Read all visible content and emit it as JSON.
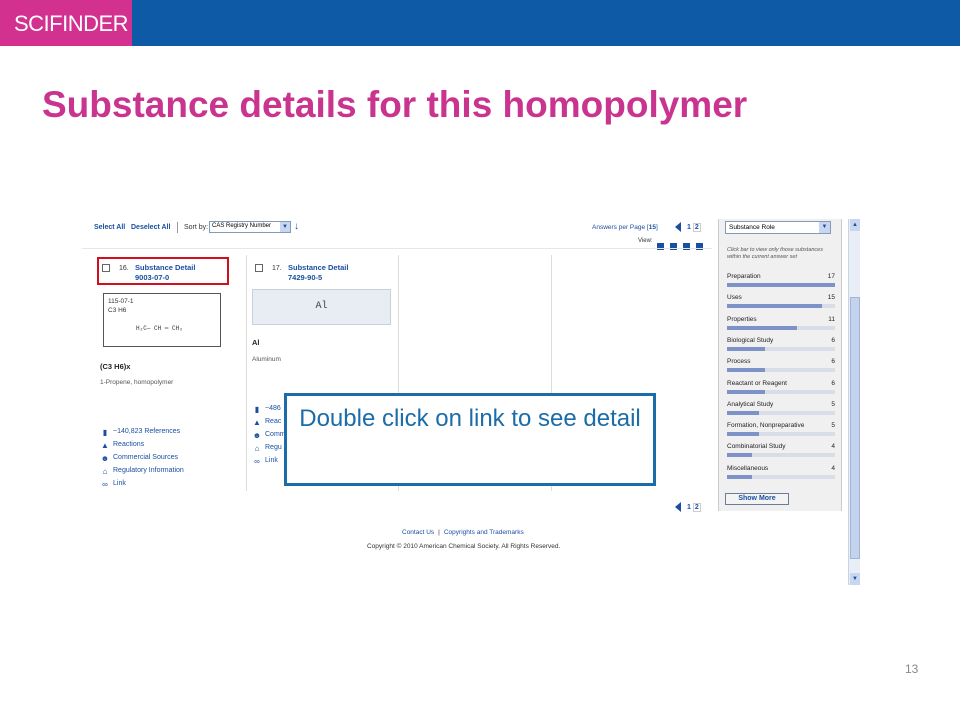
{
  "brand": "SCIFINDER",
  "title": "Substance details for this homopolymer",
  "toolbar": {
    "select_all": "Select All",
    "deselect_all": "Deselect All",
    "sort_by_label": "Sort by:",
    "sort_value": "CAS Registry Number",
    "answers_label": "Answers per Page [",
    "answers_value": "15",
    "answers_close": "]",
    "pages": [
      "1",
      "2"
    ],
    "view_label": "View:"
  },
  "results": [
    {
      "number": "16.",
      "link": "Substance Detail",
      "cas": "9003-07-0",
      "structure_lines": [
        "115-07-1",
        "C3 H6"
      ],
      "structure_chem": "H₂C— CH ═ CH₂",
      "formula": "(C3 H6)x",
      "name": "1-Propene, homopolymer",
      "links": [
        {
          "icon": "document-icon",
          "glyph": "▮",
          "label": "~140,823 References"
        },
        {
          "icon": "flask-icon",
          "glyph": "▲",
          "label": "Reactions"
        },
        {
          "icon": "people-icon",
          "glyph": "☻",
          "label": "Commercial Sources"
        },
        {
          "icon": "building-icon",
          "glyph": "⌂",
          "label": "Regulatory Information"
        },
        {
          "icon": "link-icon",
          "glyph": "∞",
          "label": "Link"
        }
      ]
    },
    {
      "number": "17.",
      "link": "Substance Detail",
      "cas": "7429-90-5",
      "structure_text": "Al",
      "formula": "Al",
      "name": "Aluminum",
      "links": [
        {
          "icon": "document-icon",
          "glyph": "▮",
          "label": "~486"
        },
        {
          "icon": "flask-icon",
          "glyph": "▲",
          "label": "Reac"
        },
        {
          "icon": "people-icon",
          "glyph": "☻",
          "label": "Comm"
        },
        {
          "icon": "building-icon",
          "glyph": "⌂",
          "label": "Regu"
        },
        {
          "icon": "link-icon",
          "glyph": "∞",
          "label": "Link"
        }
      ]
    }
  ],
  "sidebar": {
    "select_value": "Substance Role",
    "hint": "Click bar to view only those substances within the current answer set",
    "max": 17,
    "roles": [
      {
        "name": "Preparation",
        "count": 17
      },
      {
        "name": "Uses",
        "count": 15
      },
      {
        "name": "Properties",
        "count": 11
      },
      {
        "name": "Biological Study",
        "count": 6
      },
      {
        "name": "Process",
        "count": 6
      },
      {
        "name": "Reactant or Reagent",
        "count": 6
      },
      {
        "name": "Analytical Study",
        "count": 5
      },
      {
        "name": "Formation, Nonpreparative",
        "count": 5
      },
      {
        "name": "Combinatorial Study",
        "count": 4
      },
      {
        "name": "Miscellaneous",
        "count": 4
      }
    ],
    "show_more": "Show More"
  },
  "footer": {
    "contact": "Contact Us",
    "separator": "|",
    "copyrights": "Copyrights and Trademarks",
    "copyright_text": "Copyright © 2010 American Chemical Society. All Rights Reserved."
  },
  "callout": "Double click on link to see detail",
  "slide_number": "13",
  "colors": {
    "brand_pink": "#d2318f",
    "banner_blue": "#0e5aa7",
    "title_pink": "#c9348f",
    "link_blue": "#1a4fa0",
    "highlight_red": "#d20f1e",
    "callout_blue": "#1b6ca8"
  }
}
